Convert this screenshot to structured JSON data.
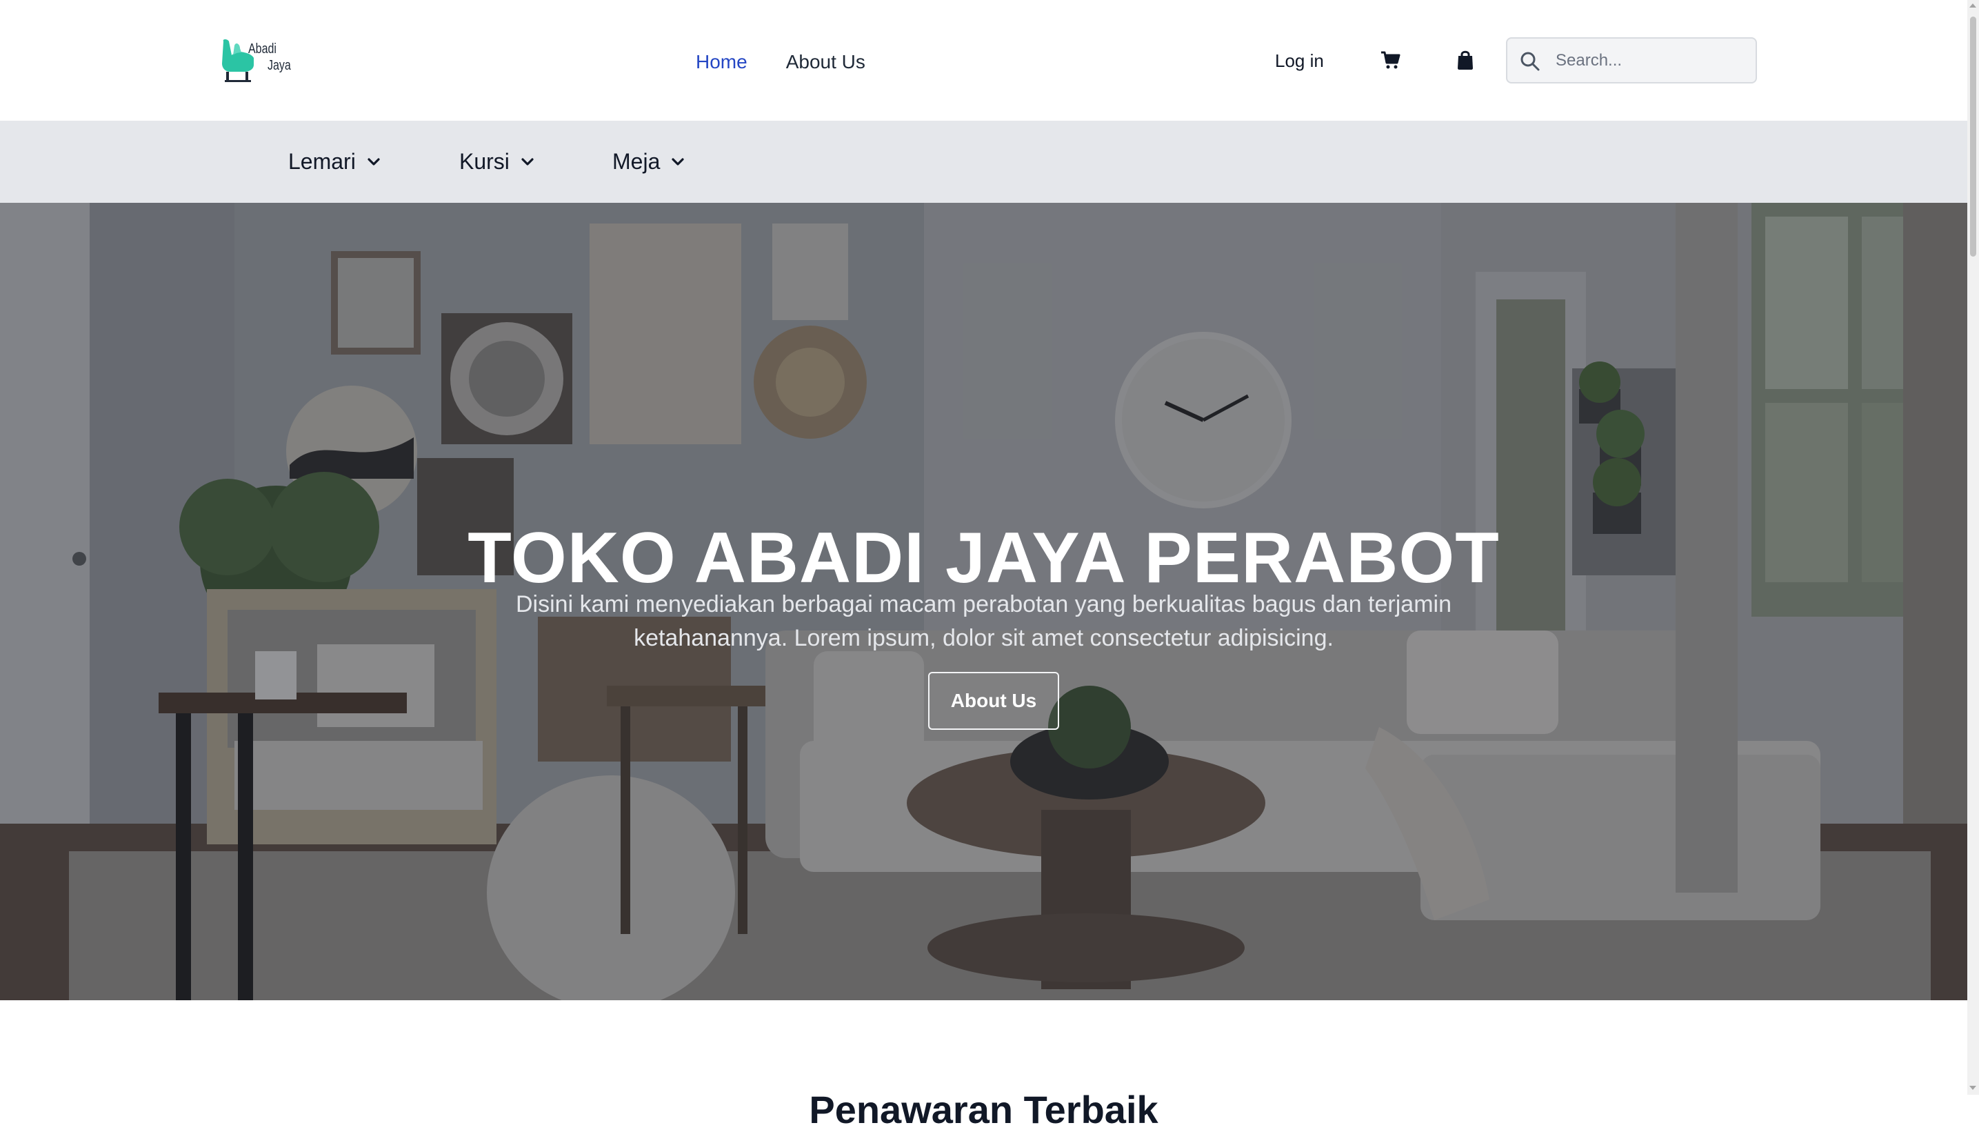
{
  "brand": {
    "name_line1": "Abadi",
    "name_line2": "Jaya",
    "logo_icon": "armchair-logo-icon",
    "accent_color": "#2bc4a4"
  },
  "nav": {
    "items": [
      {
        "label": "Home",
        "active": true
      },
      {
        "label": "About Us",
        "active": false
      }
    ],
    "active_color": "#2547c4"
  },
  "header_actions": {
    "login_label": "Log in",
    "cart_icon": "shopping-cart-icon",
    "bag_icon": "shopping-bag-icon",
    "search_placeholder": "Search...",
    "search_icon": "magnifier-icon"
  },
  "categories": [
    {
      "label": "Lemari",
      "icon": "chevron-down-icon"
    },
    {
      "label": "Kursi",
      "icon": "chevron-down-icon"
    },
    {
      "label": "Meja",
      "icon": "chevron-down-icon"
    }
  ],
  "hero": {
    "title": "TOKO ABADI JAYA PERABOT",
    "description": "Disini kami menyediakan berbagai macam perabotan yang berkualitas bagus dan terjamin ketahanannya. Lorem ipsum, dolor sit amet consectetur adipisicing.",
    "button_label": "About Us"
  },
  "sections": {
    "best_offer_title": "Penawaran Terbaik"
  }
}
